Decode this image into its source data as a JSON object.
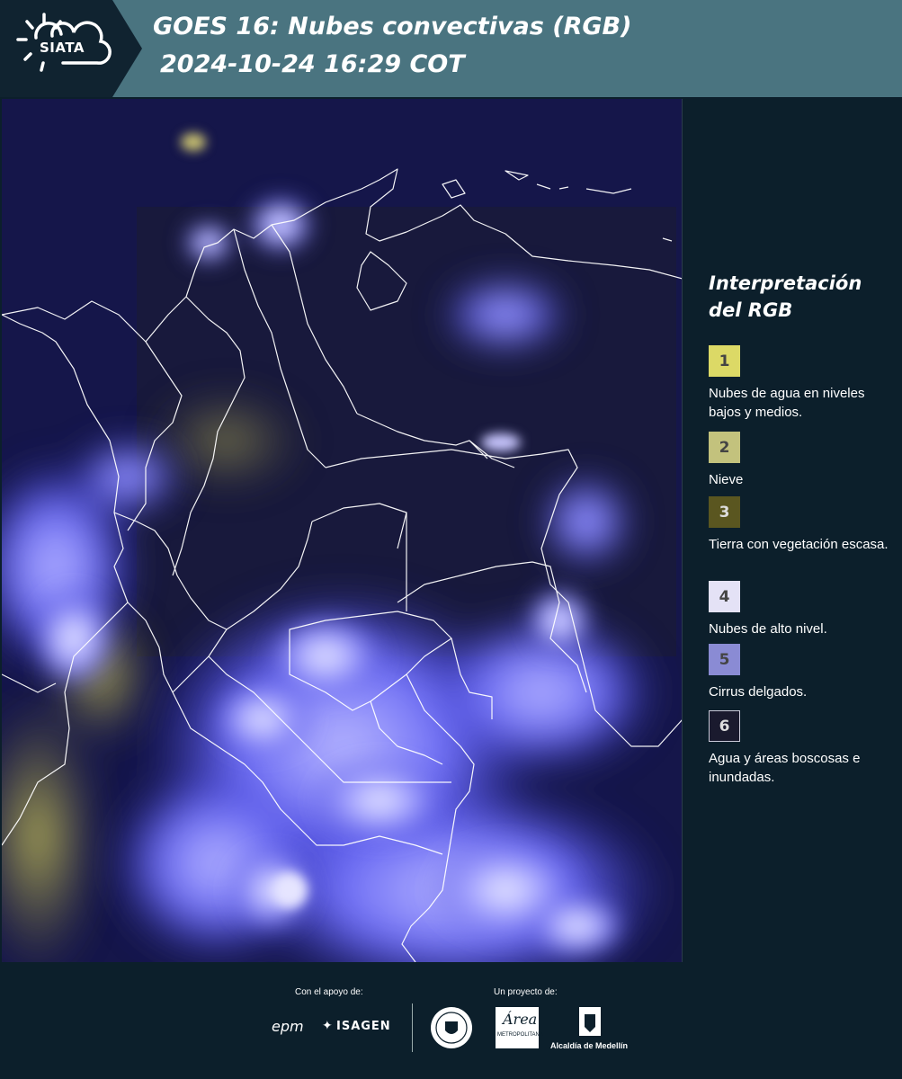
{
  "header": {
    "logo_text": "SIATA",
    "title_line1": "GOES 16: Nubes convectivas (RGB)",
    "title_line2": "2024-10-24 16:29 COT"
  },
  "legend": {
    "title_line1": "Interpretación",
    "title_line2": "del RGB",
    "items": [
      {
        "number": "1",
        "label": "Nubes de agua en niveles bajos y medios.",
        "color": "#dcd966"
      },
      {
        "number": "2",
        "label": "Nieve",
        "color": "#c3c27d"
      },
      {
        "number": "3",
        "label": "Tierra con vegetación escasa.",
        "color": "#5a5620"
      },
      {
        "number": "4",
        "label": "Nubes de alto nivel.",
        "color": "#e4e2f6"
      },
      {
        "number": "5",
        "label": "Cirrus delgados.",
        "color": "#8a8bd4"
      },
      {
        "number": "6",
        "label": "Agua y áreas boscosas e inundadas.",
        "color": "#1a1a2e"
      }
    ]
  },
  "footer": {
    "support_caption": "Con el apoyo de:",
    "project_caption": "Un proyecto de:",
    "epm_text": "epm",
    "isagen_text": "ISAGEN",
    "area_text": "Área",
    "area_subtext": "METROPOLITANA",
    "alcaldia_text": "Alcaldía de Medellín"
  },
  "map": {
    "background_color": "#15164a",
    "cloud_color": "#7070ff",
    "border_color": "#ffffff"
  }
}
